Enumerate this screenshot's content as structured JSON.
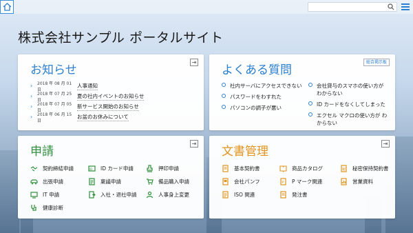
{
  "header": {
    "search_placeholder": "",
    "home_icon": "home-icon",
    "search_icon": "search-icon",
    "menu_icon": "hamburger-menu-icon"
  },
  "site_title": "株式会社サンプル ポータルサイト",
  "news": {
    "title": "お知らせ",
    "items": [
      {
        "date": "2018 年 08 月 01 日",
        "text": "人事通知"
      },
      {
        "date": "2018 年 07 月 25 日",
        "text": "夏の社内イベントのお知らせ"
      },
      {
        "date": "2018 年 07 月 05 日",
        "text": "新サービス開始のお知らせ"
      },
      {
        "date": "2018 年 06 月 15 日",
        "text": "お盆のお休みについて"
      }
    ]
  },
  "faq": {
    "title": "よくある質問",
    "archive_label": "総合掲示板",
    "left": [
      "社内サーバにアクセスできない",
      "パスワードをわすれた",
      "パソコンの調子が悪い"
    ],
    "right": [
      "会社貸与のスマホの使い方が わからない",
      "ID カードをなくしてしまった",
      "エクセル マクロの使い方が わからない"
    ]
  },
  "apply": {
    "title": "申請",
    "items": [
      {
        "label": "契約締結申請",
        "icon": "handshake-icon"
      },
      {
        "label": "ID カード申請",
        "icon": "id-card-icon"
      },
      {
        "label": "押印申請",
        "icon": "stamp-icon"
      },
      {
        "label": "出張申請",
        "icon": "car-icon"
      },
      {
        "label": "稟議申請",
        "icon": "document-icon"
      },
      {
        "label": "備品購入申請",
        "icon": "cart-icon"
      },
      {
        "label": "IT 申請",
        "icon": "computer-icon"
      },
      {
        "label": "入社・退社申請",
        "icon": "door-icon"
      },
      {
        "label": "人事身上変更",
        "icon": "person-icon"
      },
      {
        "label": "健康診断",
        "icon": "stethoscope-icon"
      }
    ]
  },
  "docs": {
    "title": "文書管理",
    "items": [
      {
        "label": "基本契約書",
        "icon": "contract-icon"
      },
      {
        "label": "商品カタログ",
        "icon": "book-icon"
      },
      {
        "label": "秘密保持契約書",
        "icon": "secret-doc-icon"
      },
      {
        "label": "会社パンフ",
        "icon": "pamphlet-icon"
      },
      {
        "label": "P マーク関連",
        "icon": "p-mark-icon"
      },
      {
        "label": "営業資料",
        "icon": "sales-doc-icon"
      },
      {
        "label": "ISO 関連",
        "icon": "iso-icon"
      },
      {
        "label": "発注書",
        "icon": "order-form-icon"
      }
    ]
  },
  "colors": {
    "blue": "#2b7fcf",
    "green": "#2f8f3c",
    "orange": "#e0941e"
  }
}
